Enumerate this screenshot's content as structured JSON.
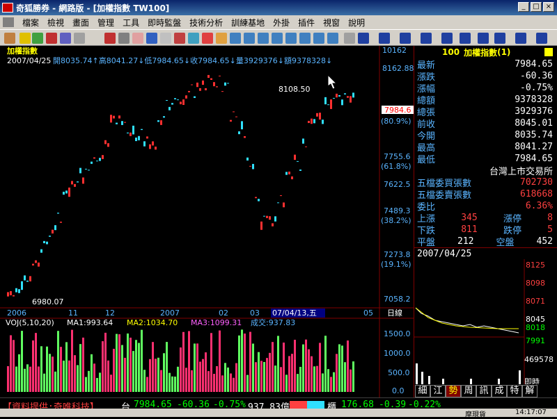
{
  "window": {
    "title": "奇狐勝券 - 網路版 - [加權指數 TW100]"
  },
  "menu": [
    "檔案",
    "檢視",
    "畫面",
    "管理",
    "工具",
    "即時監盤",
    "技術分析",
    "訓練基地",
    "外掛",
    "插件",
    "視窗",
    "說明"
  ],
  "chart": {
    "name": "加權指數",
    "info_date": "2007/04/25",
    "info": "開8035.74↑高8041.27↓低7984.65↓收7984.65↓量3929376↓額9378328↓",
    "price_axis": [
      "10162",
      "8162.88",
      "7984.6",
      "(80.9%)",
      "7755.6",
      "(61.8%)",
      "7622.5",
      "7489.3",
      "(38.2%)",
      "7273.8",
      "(19.1%)",
      "7058.2"
    ],
    "annot_high": "8108.50",
    "annot_low": "6980.07",
    "xaxis": [
      "2006",
      "11",
      "12",
      "2007",
      "02",
      "03",
      "07/04/13,五",
      "05"
    ],
    "xaxis_unit": "日線",
    "vol_label": "VOJ(5,10,20)",
    "vol_ma1": "MA1:993.64",
    "vol_ma2": "MA2:1034.70",
    "vol_ma3": "MA3:1099.31",
    "vol_amt": "成交:937.83",
    "vol_axis": [
      "1500.0",
      "1000.0",
      "500.0",
      "0.0"
    ]
  },
  "side": {
    "code": "100",
    "name": "加權指數",
    "seq": "(1)",
    "rows": [
      {
        "k": "最新",
        "v": "7984.65",
        "c": "v"
      },
      {
        "k": "漲跌",
        "v": "-60.36",
        "c": "v"
      },
      {
        "k": "漲幅",
        "v": "-0.75%",
        "c": "v"
      },
      {
        "k": "總額",
        "v": "9378328",
        "c": "v"
      },
      {
        "k": "總張",
        "v": "3929376",
        "c": "v"
      },
      {
        "k": "前收",
        "v": "8045.01",
        "c": "v"
      },
      {
        "k": "今開",
        "v": "8035.74",
        "c": "v"
      },
      {
        "k": "最高",
        "v": "8041.27",
        "c": "v"
      },
      {
        "k": "最低",
        "v": "7984.65",
        "c": "v"
      }
    ],
    "exchange": "台灣上市交易所",
    "buy_label": "五檔委買張數",
    "buy_val": "702730",
    "sell_label": "五檔委賣張數",
    "sell_val": "618668",
    "ratio_label": "委比",
    "ratio_val": "6.36%",
    "up_label": "上漲",
    "up": "345",
    "limitup_label": "漲停",
    "limitup": "8",
    "down_label": "下跌",
    "down": "811",
    "limitdown_label": "跌停",
    "limitdown": "5",
    "flat_label": "平盤",
    "flat": "212",
    "empty_label": "空盤",
    "empty": "452",
    "mini_date": "2007/04/25",
    "mini_axis": [
      "8125",
      "8098",
      "8071",
      "8045",
      "8018",
      "7991"
    ],
    "mini_vol": "469578",
    "mini_time": "即時",
    "tabs": [
      "細",
      "江",
      "勢",
      "周",
      "訊",
      "成",
      "特",
      "解"
    ]
  },
  "status": {
    "provider": "【資料提供:奇唯科技】",
    "tai": "台",
    "tai_val": "7984.65",
    "tai_chg": "-60.36",
    "tai_pct": "-0.75%",
    "tai_amt": "937.83億",
    "gui": "櫃",
    "gui_val": "176.68",
    "gui_chg": "-0.39",
    "gui_pct": "-0.22%",
    "broker": "摩現貨",
    "time": "14:17:07"
  },
  "colors": {
    "up": "#ff3030",
    "down": "#30e0ff",
    "vol_up": "#ff3070",
    "vol_dn": "#60ff60"
  }
}
